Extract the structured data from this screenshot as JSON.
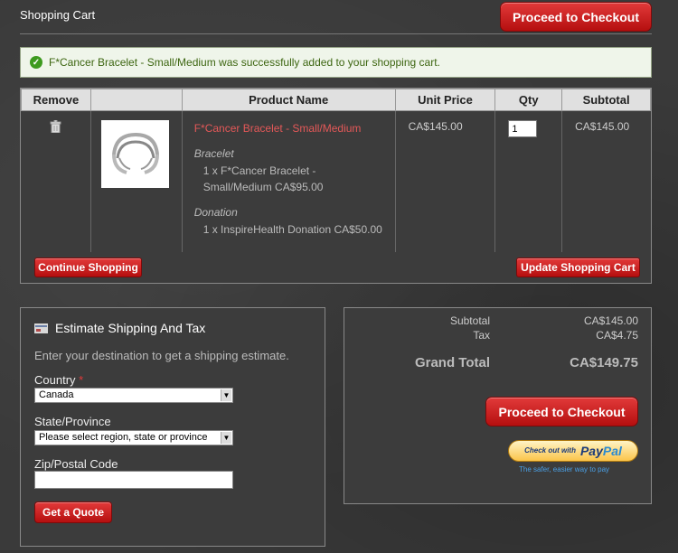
{
  "header": {
    "title": "Shopping Cart",
    "checkout_label": "Proceed to Checkout"
  },
  "success": {
    "message": "F*Cancer Bracelet - Small/Medium was successfully added to your shopping cart."
  },
  "cart": {
    "columns": [
      "Remove",
      "",
      "Product Name",
      "Unit Price",
      "Qty",
      "Subtotal"
    ],
    "items": [
      {
        "name": "F*Cancer Bracelet - Small/Medium",
        "option1_label": "Bracelet",
        "option1_value": "1 x F*Cancer Bracelet - Small/Medium CA$95.00",
        "option2_label": "Donation",
        "option2_value": "1 x InspireHealth Donation CA$50.00",
        "unit_price": "CA$145.00",
        "qty": "1",
        "subtotal": "CA$145.00"
      }
    ],
    "continue_label": "Continue Shopping",
    "update_label": "Update Shopping Cart"
  },
  "shipping": {
    "title": "Estimate Shipping And Tax",
    "intro": "Enter your destination to get a shipping estimate.",
    "country_label": "Country",
    "required_mark": "*",
    "country_value": "Canada",
    "state_label": "State/Province",
    "state_value": "Please select region, state or province",
    "zip_label": "Zip/Postal Code",
    "zip_value": "",
    "quote_label": "Get a Quote"
  },
  "totals": {
    "subtotal_label": "Subtotal",
    "subtotal_value": "CA$145.00",
    "tax_label": "Tax",
    "tax_value": "CA$4.75",
    "grand_label": "Grand Total",
    "grand_value": "CA$149.75",
    "checkout_label": "Proceed to Checkout",
    "paypal_small": "Check out with",
    "paypal_logo_pay": "Pay",
    "paypal_logo_pal": "Pal",
    "paypal_tagline": "The safer, easier way to pay"
  },
  "colors": {
    "accent": "#c91414",
    "link": "#e45858",
    "success_text": "#3d6611",
    "background": "#3a3a3a"
  },
  "icons": [
    "success-check-icon",
    "remove-trash-icon",
    "shipping-icon"
  ]
}
